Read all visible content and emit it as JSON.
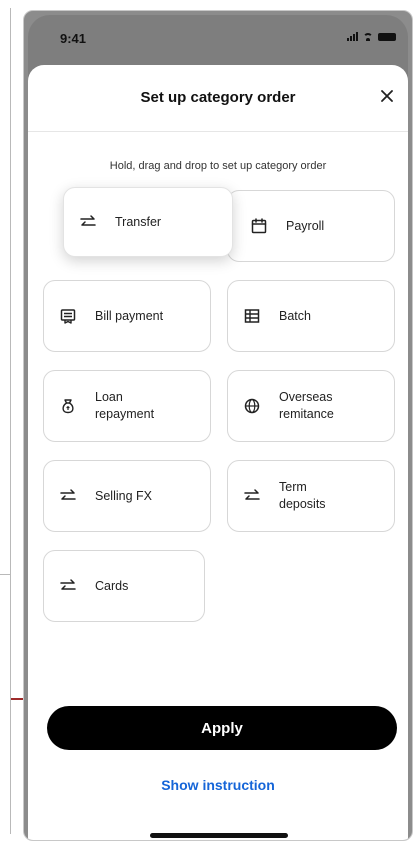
{
  "status_bar": {
    "time": "9:41"
  },
  "sheet": {
    "title": "Set up category order",
    "instruction": "Hold, drag and drop to set up category order"
  },
  "categories": [
    {
      "label": "Transfer",
      "icon": "transfer-arrows-icon",
      "state": "dragging"
    },
    {
      "label": "Payroll",
      "icon": "calendar-icon"
    },
    {
      "label": "Bill payment",
      "icon": "receipt-icon"
    },
    {
      "label": "Batch",
      "icon": "table-icon"
    },
    {
      "label": "Loan\nrepayment",
      "icon": "money-bag-icon"
    },
    {
      "label": "Overseas\nremitance",
      "icon": "globe-icon"
    },
    {
      "label": "Selling FX",
      "icon": "transfer-arrows-icon"
    },
    {
      "label": "Term\ndeposits",
      "icon": "transfer-arrows-icon"
    },
    {
      "label": "Cards",
      "icon": "transfer-arrows-icon"
    }
  ],
  "actions": {
    "apply": "Apply",
    "show_instruction": "Show instruction"
  },
  "colors": {
    "primary_button": "#000000",
    "link": "#1565d8",
    "annotation_arrow": "#9e2a2a"
  }
}
